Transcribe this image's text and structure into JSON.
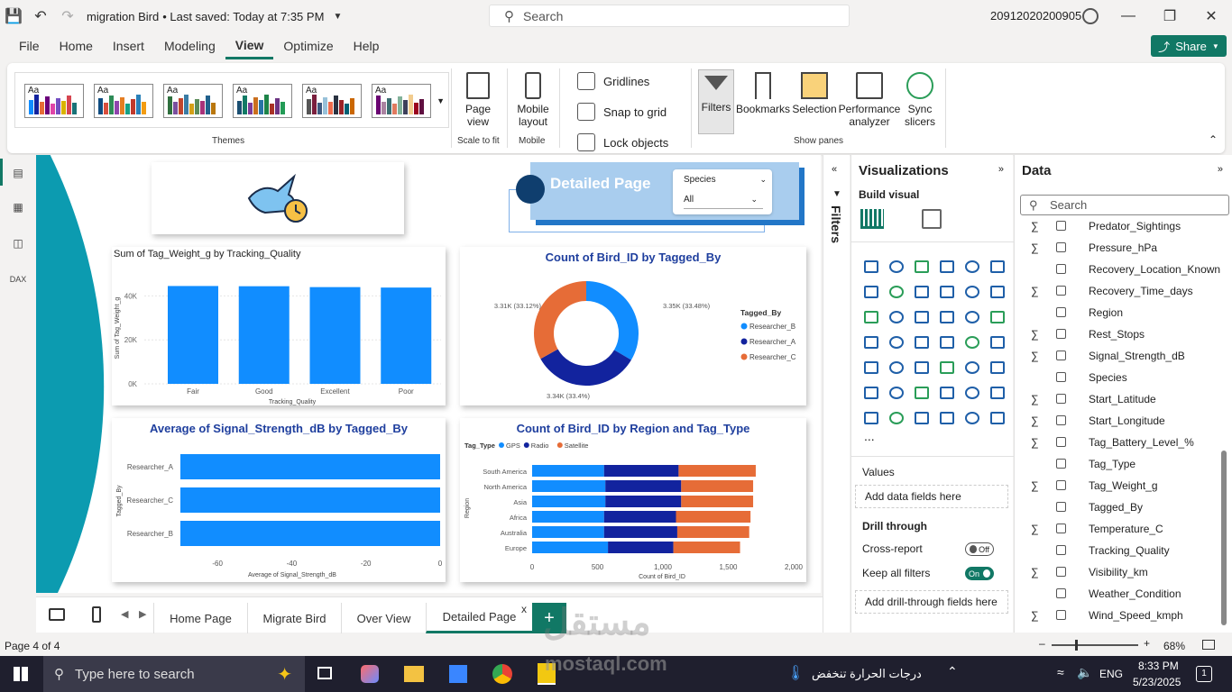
{
  "titlebar": {
    "file_title": "migration Bird",
    "saved": "• Last saved: Today at 7:35 PM",
    "search_placeholder": "Search",
    "user_id": "20912020200905"
  },
  "menu": {
    "items": [
      "File",
      "Home",
      "Insert",
      "Modeling",
      "View",
      "Optimize",
      "Help"
    ],
    "active": "View",
    "share": "Share"
  },
  "ribbon": {
    "themes_caption": "Themes",
    "page_view": "Page view",
    "scale_to_fit": "Scale to fit",
    "mobile_layout": "Mobile layout",
    "mobile_caption": "Mobile",
    "gridlines": "Gridlines",
    "snap_to_grid": "Snap to grid",
    "lock_objects": "Lock objects",
    "panes": [
      "Filters",
      "Bookmarks",
      "Selection",
      "Performance analyzer",
      "Sync slicers"
    ],
    "show_panes_caption": "Show panes"
  },
  "report": {
    "detailed_title": "Detailed Page",
    "slicer_label": "Species",
    "slicer_value": "All",
    "chart1_title": "Sum of Tag_Weight_g by Tracking_Quality",
    "chart2_title": "Count of Bird_ID by Tagged_By",
    "chart3_title": "Average of Signal_Strength_dB by Tagged_By",
    "chart4_title": "Count of Bird_ID by Region and Tag_Type"
  },
  "chart_data": [
    {
      "type": "bar",
      "title": "Sum of Tag_Weight_g by Tracking_Quality",
      "categories": [
        "Fair",
        "Good",
        "Excellent",
        "Poor"
      ],
      "values": [
        44500,
        44400,
        44000,
        43800
      ],
      "xlabel": "Tracking_Quality",
      "ylabel": "Sum of Tag_Weight_g",
      "yticks": [
        "0K",
        "20K",
        "40K"
      ],
      "ylim": [
        0,
        50000
      ]
    },
    {
      "type": "pie",
      "title": "Count of Bird_ID by Tagged_By",
      "legend_title": "Tagged_By",
      "series": [
        {
          "name": "Researcher_B",
          "value": 3350,
          "label": "3.35K (33.48%)",
          "color": "#118DFF"
        },
        {
          "name": "Researcher_A",
          "value": 3340,
          "label": "3.34K (33.4%)",
          "color": "#12239E"
        },
        {
          "name": "Researcher_C",
          "value": 3310,
          "label": "3.31K (33.12%)",
          "color": "#E66C37"
        }
      ]
    },
    {
      "type": "bar",
      "orientation": "horizontal",
      "title": "Average of Signal_Strength_dB by Tagged_By",
      "categories": [
        "Researcher_A",
        "Researcher_C",
        "Researcher_B"
      ],
      "values": [
        -70,
        -70,
        -70
      ],
      "xlabel": "Average of Signal_Strength_dB",
      "ylabel": "Tagged_By",
      "xticks": [
        "-60",
        "-40",
        "-20",
        "0"
      ],
      "xlim": [
        -70,
        0
      ]
    },
    {
      "type": "bar",
      "orientation": "horizontal",
      "stacked": true,
      "title": "Count of Bird_ID by Region and Tag_Type",
      "legend_title": "Tag_Type",
      "categories": [
        "South America",
        "North America",
        "Asia",
        "Africa",
        "Australia",
        "Europe"
      ],
      "series": [
        {
          "name": "GPS",
          "color": "#118DFF",
          "values": [
            550,
            560,
            560,
            550,
            550,
            580
          ]
        },
        {
          "name": "Radio",
          "color": "#12239E",
          "values": [
            570,
            580,
            580,
            550,
            560,
            500
          ]
        },
        {
          "name": "Satellite",
          "color": "#E66C37",
          "values": [
            590,
            550,
            550,
            570,
            550,
            510
          ]
        }
      ],
      "xlabel": "Count of Bird_ID",
      "ylabel": "Region",
      "xticks": [
        "0",
        "500",
        "1,000",
        "1,500",
        "2,000"
      ],
      "xlim": [
        0,
        2000
      ]
    }
  ],
  "pages": {
    "tabs": [
      "Home Page",
      "Migrate Bird",
      "Over View",
      "Detailed Page"
    ],
    "active": "Detailed Page",
    "close": "x",
    "add": "+"
  },
  "filters_label": "Filters",
  "viz": {
    "title": "Visualizations",
    "build_visual": "Build visual",
    "values_label": "Values",
    "add_data_fields": "Add data fields here",
    "drill_through": "Drill through",
    "cross_report": "Cross-report",
    "cross_report_state": "Off",
    "keep_all_filters": "Keep all filters",
    "keep_all_filters_state": "On",
    "add_drill_fields": "Add drill-through fields here",
    "more": "..."
  },
  "data_pane": {
    "title": "Data",
    "search_placeholder": "Search",
    "fields": [
      {
        "name": "Predator_Sightings",
        "sigma": true
      },
      {
        "name": "Pressure_hPa",
        "sigma": true
      },
      {
        "name": "Recovery_Location_Known",
        "sigma": false
      },
      {
        "name": "Recovery_Time_days",
        "sigma": true
      },
      {
        "name": "Region",
        "sigma": false
      },
      {
        "name": "Rest_Stops",
        "sigma": true
      },
      {
        "name": "Signal_Strength_dB",
        "sigma": true
      },
      {
        "name": "Species",
        "sigma": false
      },
      {
        "name": "Start_Latitude",
        "sigma": true
      },
      {
        "name": "Start_Longitude",
        "sigma": true
      },
      {
        "name": "Tag_Battery_Level_%",
        "sigma": true
      },
      {
        "name": "Tag_Type",
        "sigma": false
      },
      {
        "name": "Tag_Weight_g",
        "sigma": true
      },
      {
        "name": "Tagged_By",
        "sigma": false
      },
      {
        "name": "Temperature_C",
        "sigma": true
      },
      {
        "name": "Tracking_Quality",
        "sigma": false
      },
      {
        "name": "Visibility_km",
        "sigma": true
      },
      {
        "name": "Weather_Condition",
        "sigma": false
      },
      {
        "name": "Wind_Speed_kmph",
        "sigma": true
      }
    ]
  },
  "status": {
    "page": "Page 4 of 4",
    "zoom": "68%"
  },
  "taskbar": {
    "search": "Type here to search",
    "weather": "درجات الحرارة تنخفض",
    "lang": "ENG",
    "time": "8:33 PM",
    "date": "5/23/2025",
    "notif": "1"
  },
  "watermark": {
    "arabic": "مستقل",
    "site": "mostaql.com"
  },
  "colors": {
    "accent": "#117865",
    "blue": "#118DFF",
    "navy": "#12239E",
    "orange": "#E66C37",
    "teal": "#0c9bb0"
  }
}
